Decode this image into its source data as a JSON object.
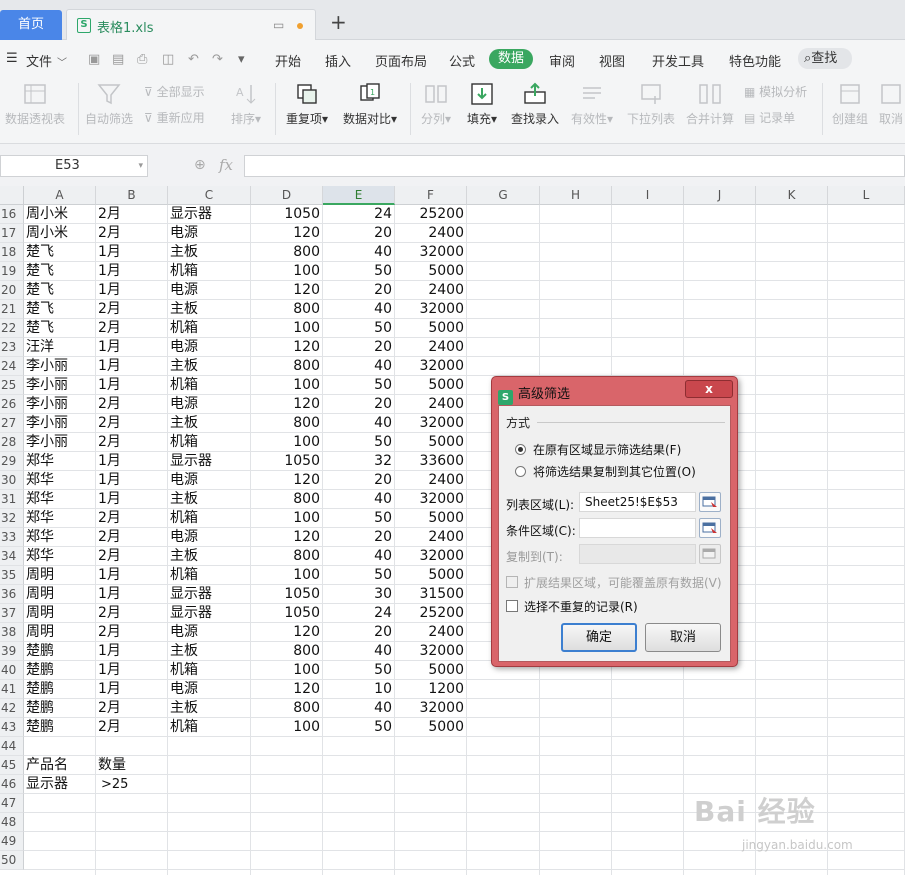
{
  "tabs": {
    "home": "首页",
    "file": "表格1.xls"
  },
  "menu": {
    "file": "文件",
    "items": [
      "开始",
      "插入",
      "页面布局",
      "公式"
    ],
    "active": "数据",
    "items_after": [
      "审阅",
      "视图",
      "开发工具",
      "特色功能"
    ],
    "search": "查找"
  },
  "toolbar": {
    "pivot": "数据透视表",
    "autofilter": "自动筛选",
    "show_all": "全部显示",
    "reapply": "重新应用",
    "sort": "排序",
    "duplicates": "重复项",
    "compare": "数据对比",
    "split": "分列",
    "fill": "填充",
    "lookup": "查找录入",
    "validity": "有效性",
    "dropdown": "下拉列表",
    "consolidate": "合并计算",
    "simulate": "模拟分析",
    "record": "记录单",
    "group": "创建组",
    "ungroup": "取消"
  },
  "formula": {
    "cell_ref": "E53",
    "fx": "fx",
    "content": ""
  },
  "grid": {
    "columns": [
      "A",
      "B",
      "C",
      "D",
      "E",
      "F",
      "G",
      "H",
      "I",
      "J",
      "K",
      "L"
    ],
    "selected_column": "E",
    "rows": [
      {
        "n": "16",
        "a": "周小米",
        "b": "2月",
        "c": "显示器",
        "d": "1050",
        "e": "24",
        "f": "25200"
      },
      {
        "n": "17",
        "a": "周小米",
        "b": "2月",
        "c": "电源",
        "d": "120",
        "e": "20",
        "f": "2400"
      },
      {
        "n": "18",
        "a": "楚飞",
        "b": "1月",
        "c": "主板",
        "d": "800",
        "e": "40",
        "f": "32000"
      },
      {
        "n": "19",
        "a": "楚飞",
        "b": "1月",
        "c": "机箱",
        "d": "100",
        "e": "50",
        "f": "5000"
      },
      {
        "n": "20",
        "a": "楚飞",
        "b": "1月",
        "c": "电源",
        "d": "120",
        "e": "20",
        "f": "2400"
      },
      {
        "n": "21",
        "a": "楚飞",
        "b": "2月",
        "c": "主板",
        "d": "800",
        "e": "40",
        "f": "32000"
      },
      {
        "n": "22",
        "a": "楚飞",
        "b": "2月",
        "c": "机箱",
        "d": "100",
        "e": "50",
        "f": "5000"
      },
      {
        "n": "23",
        "a": "汪洋",
        "b": "1月",
        "c": "电源",
        "d": "120",
        "e": "20",
        "f": "2400"
      },
      {
        "n": "24",
        "a": "李小丽",
        "b": "1月",
        "c": "主板",
        "d": "800",
        "e": "40",
        "f": "32000"
      },
      {
        "n": "25",
        "a": "李小丽",
        "b": "1月",
        "c": "机箱",
        "d": "100",
        "e": "50",
        "f": "5000"
      },
      {
        "n": "26",
        "a": "李小丽",
        "b": "2月",
        "c": "电源",
        "d": "120",
        "e": "20",
        "f": "2400"
      },
      {
        "n": "27",
        "a": "李小丽",
        "b": "2月",
        "c": "主板",
        "d": "800",
        "e": "40",
        "f": "32000"
      },
      {
        "n": "28",
        "a": "李小丽",
        "b": "2月",
        "c": "机箱",
        "d": "100",
        "e": "50",
        "f": "5000"
      },
      {
        "n": "29",
        "a": "郑华",
        "b": "1月",
        "c": "显示器",
        "d": "1050",
        "e": "32",
        "f": "33600"
      },
      {
        "n": "30",
        "a": "郑华",
        "b": "1月",
        "c": "电源",
        "d": "120",
        "e": "20",
        "f": "2400"
      },
      {
        "n": "31",
        "a": "郑华",
        "b": "1月",
        "c": "主板",
        "d": "800",
        "e": "40",
        "f": "32000"
      },
      {
        "n": "32",
        "a": "郑华",
        "b": "2月",
        "c": "机箱",
        "d": "100",
        "e": "50",
        "f": "5000"
      },
      {
        "n": "33",
        "a": "郑华",
        "b": "2月",
        "c": "电源",
        "d": "120",
        "e": "20",
        "f": "2400"
      },
      {
        "n": "34",
        "a": "郑华",
        "b": "2月",
        "c": "主板",
        "d": "800",
        "e": "40",
        "f": "32000"
      },
      {
        "n": "35",
        "a": "周明",
        "b": "1月",
        "c": "机箱",
        "d": "100",
        "e": "50",
        "f": "5000"
      },
      {
        "n": "36",
        "a": "周明",
        "b": "1月",
        "c": "显示器",
        "d": "1050",
        "e": "30",
        "f": "31500"
      },
      {
        "n": "37",
        "a": "周明",
        "b": "2月",
        "c": "显示器",
        "d": "1050",
        "e": "24",
        "f": "25200"
      },
      {
        "n": "38",
        "a": "周明",
        "b": "2月",
        "c": "电源",
        "d": "120",
        "e": "20",
        "f": "2400"
      },
      {
        "n": "39",
        "a": "楚鹏",
        "b": "1月",
        "c": "主板",
        "d": "800",
        "e": "40",
        "f": "32000"
      },
      {
        "n": "40",
        "a": "楚鹏",
        "b": "1月",
        "c": "机箱",
        "d": "100",
        "e": "50",
        "f": "5000"
      },
      {
        "n": "41",
        "a": "楚鹏",
        "b": "1月",
        "c": "电源",
        "d": "120",
        "e": "10",
        "f": "1200"
      },
      {
        "n": "42",
        "a": "楚鹏",
        "b": "2月",
        "c": "主板",
        "d": "800",
        "e": "40",
        "f": "32000"
      },
      {
        "n": "43",
        "a": "楚鹏",
        "b": "2月",
        "c": "机箱",
        "d": "100",
        "e": "50",
        "f": "5000"
      },
      {
        "n": "44",
        "a": "",
        "b": "",
        "c": "",
        "d": "",
        "e": "",
        "f": ""
      },
      {
        "n": "45",
        "a": "产品名",
        "b": "数量",
        "c": "",
        "d": "",
        "e": "",
        "f": ""
      },
      {
        "n": "46",
        "a": "显示器",
        "b": ">25",
        "c": "",
        "d": "",
        "e": "",
        "f": ""
      },
      {
        "n": "47",
        "a": "",
        "b": "",
        "c": "",
        "d": "",
        "e": "",
        "f": ""
      },
      {
        "n": "48",
        "a": "",
        "b": "",
        "c": "",
        "d": "",
        "e": "",
        "f": ""
      },
      {
        "n": "49",
        "a": "",
        "b": "",
        "c": "",
        "d": "",
        "e": "",
        "f": ""
      },
      {
        "n": "50",
        "a": "",
        "b": "",
        "c": "",
        "d": "",
        "e": "",
        "f": ""
      }
    ]
  },
  "dialog": {
    "title": "高级筛选",
    "close": "x",
    "group_label": "方式",
    "radio1": "在原有区域显示筛选结果(F)",
    "radio2": "将筛选结果复制到其它位置(O)",
    "list_range_label": "列表区域(L):",
    "list_range_value": "Sheet25!$E$53",
    "criteria_label": "条件区域(C):",
    "criteria_value": "",
    "copy_to_label": "复制到(T):",
    "copy_to_value": "",
    "expand_label": "扩展结果区域，可能覆盖原有数据(V)",
    "unique_label": "选择不重复的记录(R)",
    "ok": "确定",
    "cancel": "取消"
  },
  "watermark": {
    "main": "Bai 经验",
    "sub": "jingyan.baidu.com"
  }
}
